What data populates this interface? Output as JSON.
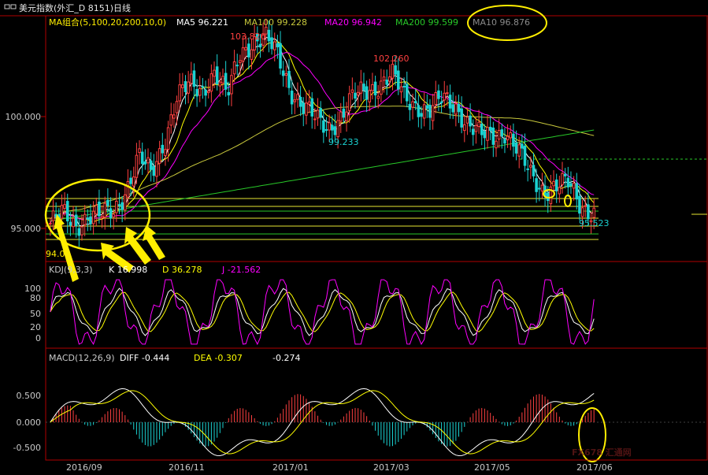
{
  "title_bar": {
    "icon": "window-icon",
    "text": "美元指数(外汇_D 8151)日线"
  },
  "colors": {
    "up": "#ff4040",
    "down": "#1ad2d2",
    "ma5": "#ffffff",
    "ma10": "#ffff00",
    "ma20": "#ff00ff",
    "ma100": "#c8c83c",
    "ma200": "#28c828",
    "frame": "#b00000",
    "axis_text": "#c8c8c8",
    "annotation": "#ffee00",
    "macd_pos": "#ff4040",
    "macd_neg": "#1ad2d2"
  },
  "main_panel": {
    "legend": {
      "ma_group": "MA组合(5,100,20,200,10,0)",
      "ma5": "MA5 96.221",
      "ma100": "MA100 99.228",
      "ma20": "MA20 96.942",
      "ma200": "MA200 99.599",
      "ma10": "MA10 96.876"
    },
    "labels": {
      "high1": "103.820",
      "high2": "102.260",
      "low1": "99.233",
      "last": "95.523",
      "min_label": "94.07"
    }
  },
  "kdj_panel": {
    "name": "KDJ(9,3,3)",
    "k": "K   16.998",
    "d": "D   36.278",
    "j": "J   -21.562",
    "ticks": [
      "100",
      "80",
      "50",
      "20",
      "0"
    ]
  },
  "macd_panel": {
    "name": "MACD(12,26,9)",
    "diff": "DIFF   -0.444",
    "dea": "DEA   -0.307",
    "macd": "-0.274",
    "ticks": [
      "0.500",
      "0.000",
      "-0.500"
    ]
  },
  "x_axis": [
    "2016/09",
    "2016/11",
    "2017/01",
    "2017/03",
    "2017/05",
    "2017/06"
  ],
  "watermark": "FX678 汇通网",
  "chart_data": [
    {
      "type": "candlestick",
      "title": "美元指数(外汇_D 8151)日线",
      "x": [
        "2016/09",
        "2016/11",
        "2017/01",
        "2017/03",
        "2017/05",
        "2017/06"
      ],
      "y_ticks": [
        "100.000",
        "95.000"
      ],
      "ylim": [
        93.9,
        104.5
      ],
      "series_close_approx": [
        95.5,
        95.9,
        95.4,
        95.9,
        95.8,
        96.0,
        97.0,
        98.4,
        97.6,
        99.1,
        101.0,
        101.5,
        101.3,
        102.2,
        101.0,
        102.9,
        103.5,
        103.6,
        102.8,
        101.4,
        100.6,
        100.0,
        99.7,
        100.2,
        101.0,
        101.3,
        101.6,
        102.0,
        101.0,
        100.7,
        100.4,
        100.9,
        100.7,
        99.9,
        99.3,
        99.3,
        99.6,
        98.6,
        97.6,
        97.0,
        97.1,
        97.2,
        96.3,
        96.0
      ],
      "annotations": [
        "103.820",
        "102.260",
        "99.233",
        "95.523",
        "94.07"
      ],
      "ma_lines": [
        "MA5 96.221",
        "MA10 96.876",
        "MA20 96.942",
        "MA100 99.228",
        "MA200 99.599"
      ]
    },
    {
      "type": "line",
      "title": "KDJ(9,3,3)",
      "series": [
        {
          "name": "K",
          "last": 16.998
        },
        {
          "name": "D",
          "last": 36.278
        },
        {
          "name": "J",
          "last": -21.562
        }
      ],
      "y_ticks": [
        100,
        80,
        50,
        20,
        0
      ]
    },
    {
      "type": "bar",
      "title": "MACD(12,26,9)",
      "series": [
        {
          "name": "DIFF",
          "last": -0.444
        },
        {
          "name": "DEA",
          "last": -0.307
        },
        {
          "name": "MACD",
          "last": -0.274
        }
      ],
      "y_ticks": [
        0.5,
        0.0,
        -0.5
      ]
    }
  ]
}
